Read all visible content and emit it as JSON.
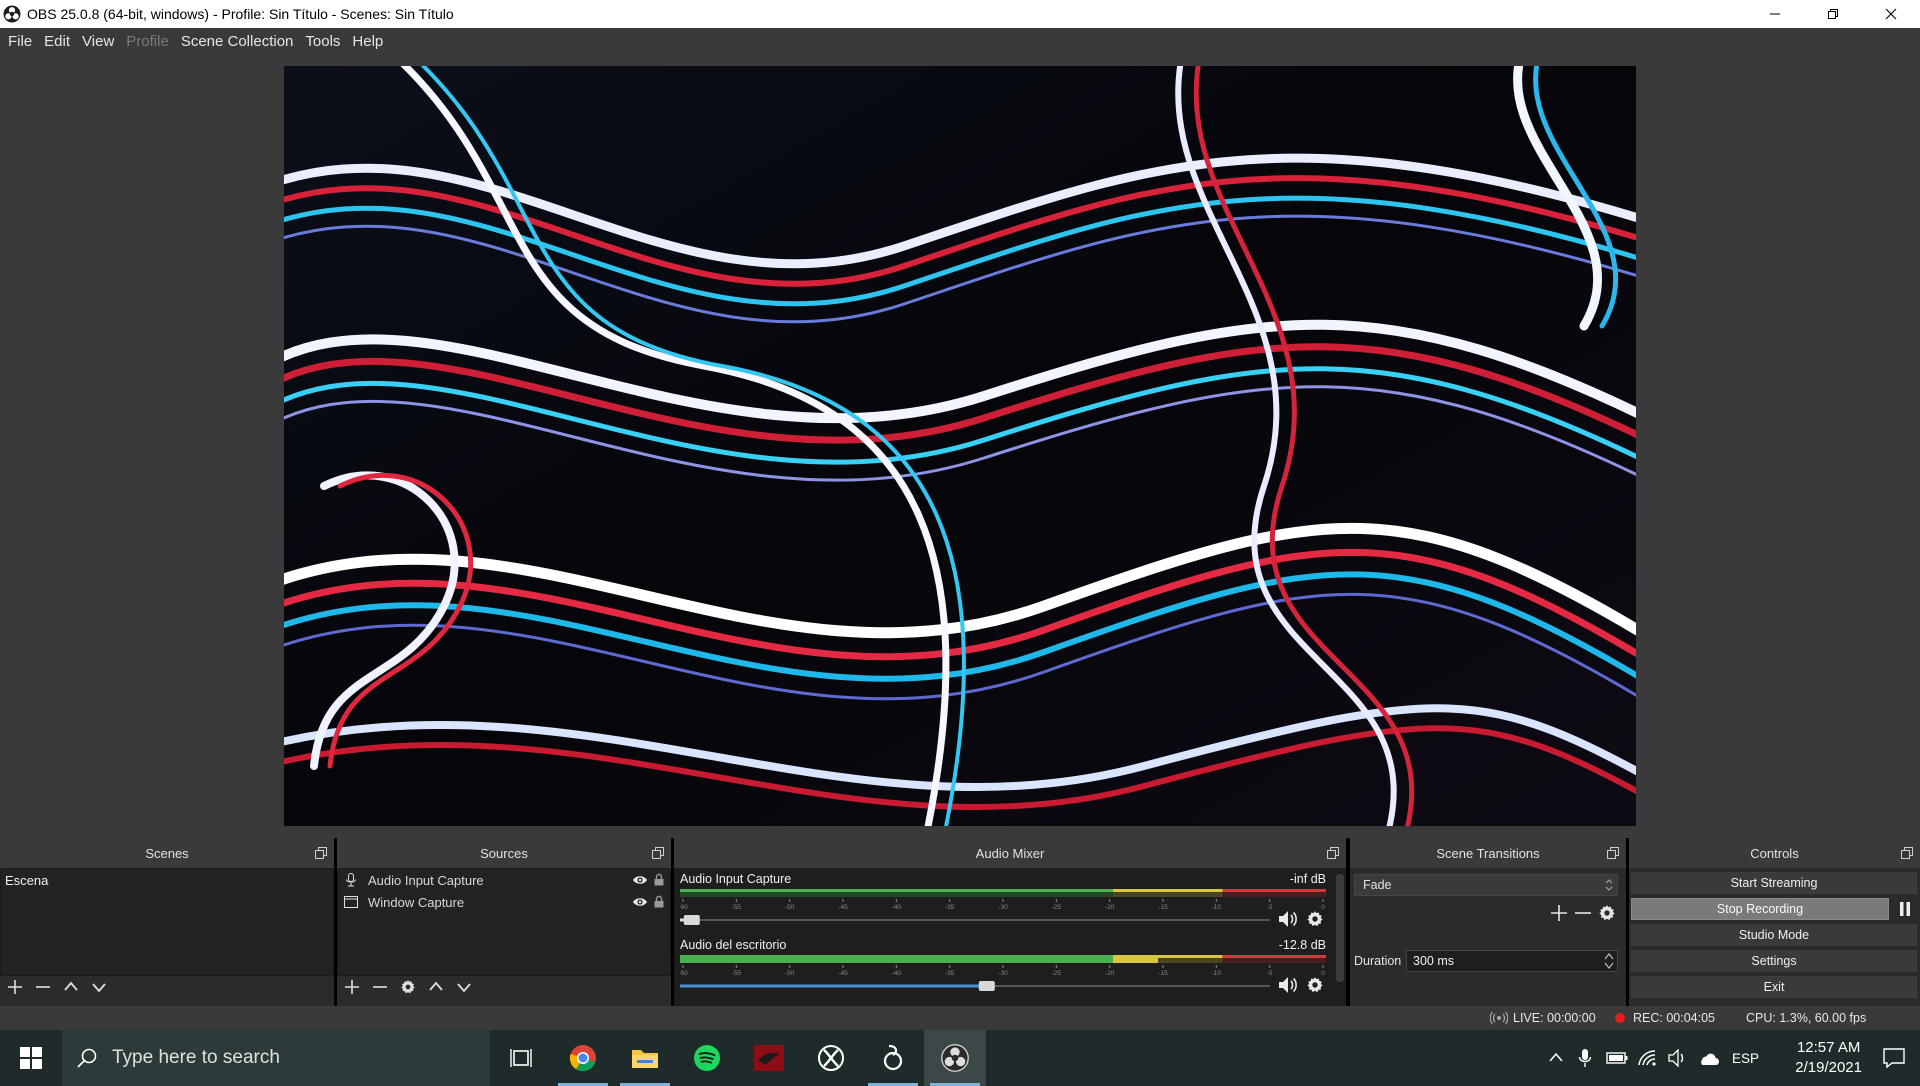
{
  "window": {
    "title": "OBS 25.0.8 (64-bit, windows) - Profile: Sin Título - Scenes: Sin Título",
    "icons": [
      "obs-logo-icon",
      "minimize-icon",
      "maximize-icon",
      "close-icon"
    ]
  },
  "menu": {
    "items": [
      {
        "label": "File",
        "enabled": true
      },
      {
        "label": "Edit",
        "enabled": true
      },
      {
        "label": "View",
        "enabled": true
      },
      {
        "label": "Profile",
        "enabled": false
      },
      {
        "label": "Scene Collection",
        "enabled": true
      },
      {
        "label": "Tools",
        "enabled": true
      },
      {
        "label": "Help",
        "enabled": true
      }
    ]
  },
  "scenes": {
    "title": "Scenes",
    "items": [
      "Escena"
    ]
  },
  "sources": {
    "title": "Sources",
    "items": [
      {
        "name": "Audio Input Capture",
        "icon": "microphone-icon",
        "visible": true,
        "locked": true
      },
      {
        "name": "Window Capture",
        "icon": "window-icon",
        "visible": true,
        "locked": true
      }
    ]
  },
  "mixer": {
    "title": "Audio Mixer",
    "scale_labels": [
      "-60",
      "-55",
      "-50",
      "-45",
      "-40",
      "-35",
      "-30",
      "-25",
      "-20",
      "-15",
      "-10",
      "-5",
      "0"
    ],
    "channels": [
      {
        "name": "Audio Input Capture",
        "db": "-inf dB",
        "level": 0.0,
        "fader": 0.02,
        "fader_color": "#dddddd"
      },
      {
        "name": "Audio del escritorio",
        "db": "-12.8 dB",
        "level": 0.74,
        "fader": 0.52,
        "fader_color": "#4a90d9"
      }
    ]
  },
  "transitions": {
    "title": "Scene Transitions",
    "selected": "Fade",
    "duration_label": "Duration",
    "duration_value": "300 ms"
  },
  "controls": {
    "title": "Controls",
    "start_streaming": "Start Streaming",
    "stop_recording": "Stop Recording",
    "studio_mode": "Studio Mode",
    "settings": "Settings",
    "exit": "Exit"
  },
  "status": {
    "live": "LIVE: 00:00:00",
    "rec": "REC: 00:04:05",
    "cpu": "CPU: 1.3%, 60.00 fps"
  },
  "taskbar": {
    "search_placeholder": "Type here to search",
    "apps": [
      "task-view-icon",
      "chrome-icon",
      "file-explorer-icon",
      "spotify-icon",
      "red-app-icon",
      "xbox-icon",
      "tweaks-app-icon",
      "obs-icon"
    ],
    "language": "ESP",
    "time": "12:57 AM",
    "date": "2/19/2021"
  },
  "colors": {
    "meter_green": "#4caf50",
    "meter_yellow": "#d6c640",
    "meter_red": "#d03a3a",
    "accent_blue": "#4a90d9"
  }
}
